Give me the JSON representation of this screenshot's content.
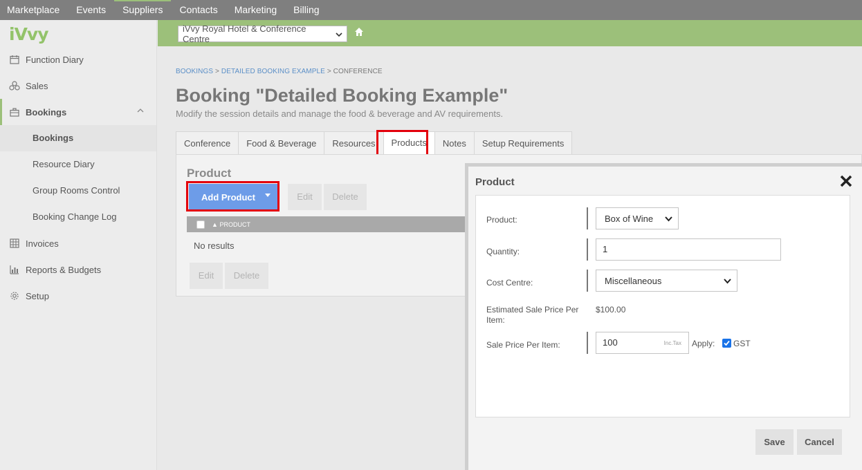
{
  "topnav": {
    "items": [
      "Marketplace",
      "Events",
      "Suppliers",
      "Contacts",
      "Marketing",
      "Billing"
    ]
  },
  "sidebar": {
    "logo": "iVvy",
    "items": [
      {
        "label": "Function Diary",
        "icon": "calendar-icon"
      },
      {
        "label": "Sales",
        "icon": "sales-icon"
      },
      {
        "label": "Bookings",
        "icon": "briefcase-icon"
      },
      {
        "label": "Invoices",
        "icon": "grid-icon"
      },
      {
        "label": "Reports & Budgets",
        "icon": "bar-chart-icon"
      },
      {
        "label": "Setup",
        "icon": "gear-icon"
      }
    ],
    "subitems": [
      "Bookings",
      "Resource Diary",
      "Group Rooms Control",
      "Booking Change Log"
    ]
  },
  "hotel": {
    "selected": "iVvy Royal Hotel & Conference Centre"
  },
  "breadcrumb": {
    "items": [
      "BOOKINGS",
      "DETAILED BOOKING EXAMPLE",
      "CONFERENCE"
    ],
    "separator": ">"
  },
  "page": {
    "title": "Booking \"Detailed Booking Example\"",
    "subtitle": "Modify the session details and manage the food & beverage and AV requirements."
  },
  "tabs": [
    "Conference",
    "Food & Beverage",
    "Resources",
    "Products",
    "Notes",
    "Setup Requirements"
  ],
  "active_tab": "Products",
  "product_panel": {
    "title": "Product",
    "add_label": "Add Product",
    "edit_label": "Edit",
    "delete_label": "Delete",
    "column_header": "PRODUCT",
    "empty_text": "No results"
  },
  "modal": {
    "title": "Product",
    "fields": {
      "product_label": "Product:",
      "product_value": "Box of Wine",
      "quantity_label": "Quantity:",
      "quantity_value": "1",
      "cost_centre_label": "Cost Centre:",
      "cost_centre_value": "Miscellaneous",
      "est_price_label": "Estimated Sale Price Per Item:",
      "est_price_value": "$100.00",
      "sale_price_label": "Sale Price Per Item:",
      "sale_price_value": "100",
      "inc_tax": "Inc.Tax",
      "apply_label": "Apply:",
      "gst_label": "GST",
      "gst_checked": true
    },
    "save_label": "Save",
    "cancel_label": "Cancel"
  },
  "colors": {
    "accent_green": "#9cc07a",
    "button_blue": "#6d9ce8",
    "highlight_red": "#e3000b",
    "topnav_gray": "#7f7f7f"
  }
}
